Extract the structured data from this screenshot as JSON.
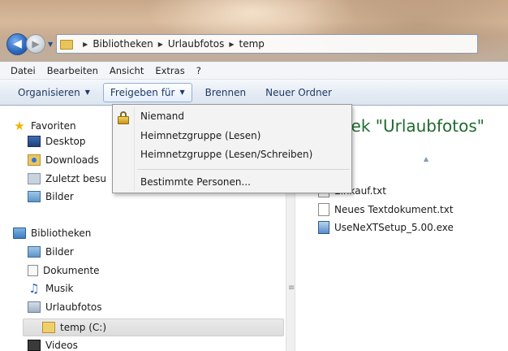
{
  "address_bar": {
    "crumbs": [
      "Bibliotheken",
      "Urlaubfotos",
      "temp"
    ]
  },
  "menu": [
    "Datei",
    "Bearbeiten",
    "Ansicht",
    "Extras",
    "?"
  ],
  "toolbar": {
    "organize": "Organisieren",
    "share": "Freigeben für",
    "burn": "Brennen",
    "new_folder": "Neuer Ordner"
  },
  "share_menu": {
    "items": [
      "Niemand",
      "Heimnetzgruppe (Lesen)",
      "Heimnetzgruppe (Lesen/Schreiben)",
      "Bestimmte Personen..."
    ]
  },
  "navigation": {
    "favorites": {
      "label": "Favoriten",
      "items": [
        "Desktop",
        "Downloads",
        "Zuletzt besu",
        "Bilder"
      ]
    },
    "libraries": {
      "label": "Bibliotheken",
      "items": [
        "Bilder",
        "Dokumente",
        "Musik",
        "Urlaubfotos"
      ],
      "subfolder": "temp (C:)",
      "videos": "Videos"
    }
  },
  "content": {
    "title": "thek \"Urlaubfotos\"",
    "files": [
      "Einkauf.txt",
      "Neues Textdokument.txt",
      "UseNeXTSetup_5.00.exe"
    ]
  },
  "icons": {
    "back": "back-arrow-icon",
    "forward": "forward-arrow-icon",
    "lock": "lock-icon",
    "star": "star-icon"
  }
}
